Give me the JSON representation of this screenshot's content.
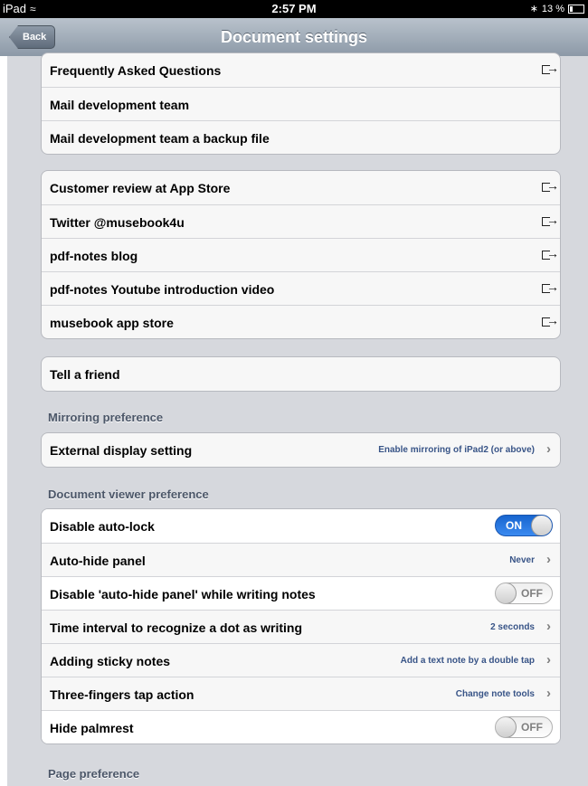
{
  "status_bar": {
    "device": "iPad",
    "time": "2:57 PM",
    "battery": "13 %"
  },
  "nav": {
    "back": "Back",
    "title": "Document settings"
  },
  "groups": {
    "support": [
      {
        "label": "Frequently Asked Questions",
        "icon": "external-link-icon"
      },
      {
        "label": "Mail development team"
      },
      {
        "label": "Mail development team a backup file"
      }
    ],
    "links": [
      {
        "label": "Customer review at App Store",
        "icon": "external-link-icon"
      },
      {
        "label": "Twitter @musebook4u",
        "icon": "external-link-icon"
      },
      {
        "label": "pdf-notes blog",
        "icon": "external-link-icon"
      },
      {
        "label": "pdf-notes Youtube introduction video",
        "icon": "external-link-icon"
      },
      {
        "label": "musebook app store",
        "icon": "external-link-icon"
      }
    ],
    "share": [
      {
        "label": "Tell a friend"
      }
    ]
  },
  "mirroring": {
    "title": "Mirroring preference",
    "rows": [
      {
        "label": "External display setting",
        "value": "Enable mirroring of iPad2 (or above)"
      }
    ]
  },
  "viewer": {
    "title": "Document viewer preference",
    "rows": [
      {
        "label": "Disable auto-lock",
        "toggle": "ON"
      },
      {
        "label": "Auto-hide panel",
        "value": "Never"
      },
      {
        "label": "Disable 'auto-hide panel' while writing notes",
        "toggle": "OFF"
      },
      {
        "label": "Time interval to recognize a dot as writing",
        "value": "2 seconds"
      },
      {
        "label": "Adding sticky notes",
        "value": "Add a text note by a double tap"
      },
      {
        "label": "Three-fingers tap action",
        "value": "Change note tools"
      },
      {
        "label": "Hide palmrest",
        "toggle": "OFF"
      }
    ]
  },
  "page_pref": {
    "title": "Page preference"
  },
  "colors": {
    "accent_blue": "#1f6fdc",
    "value_text": "#385487",
    "group_bg": "#d6d8dd"
  }
}
